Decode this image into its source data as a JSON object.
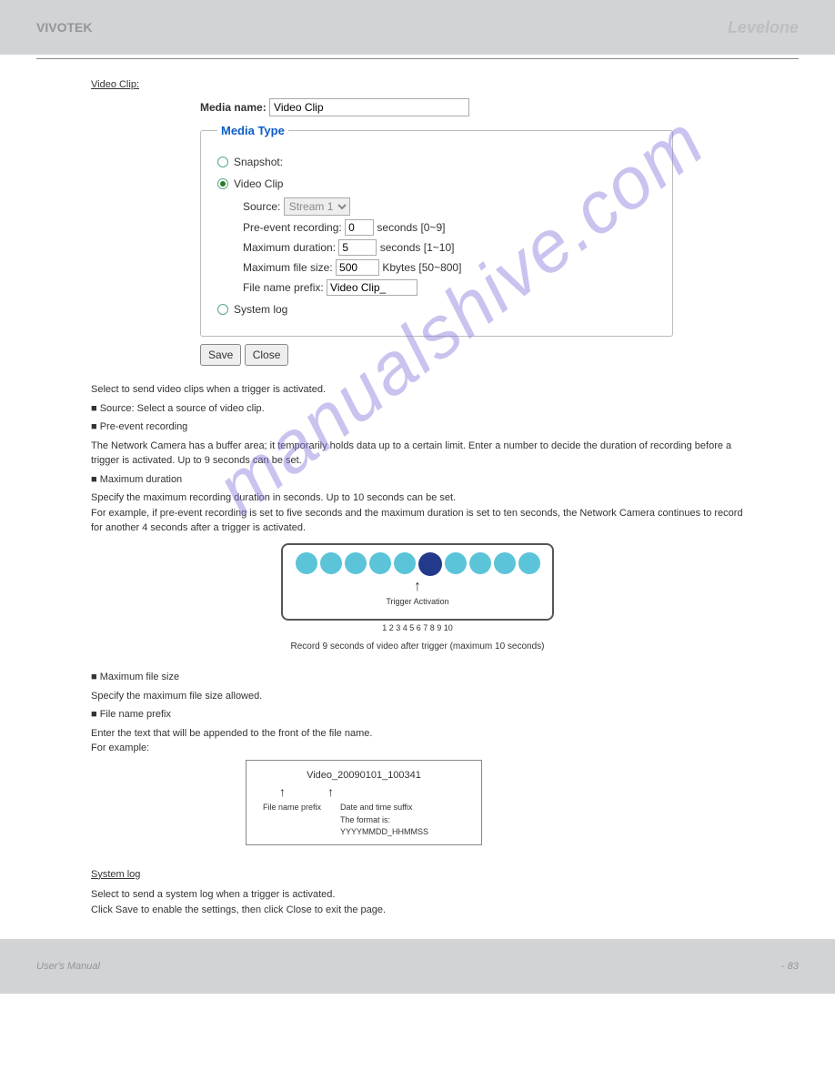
{
  "header": {
    "title": "VIVOTEK",
    "logo": "Levelone"
  },
  "watermark": "manualshive.com",
  "section_video_clip": "Video Clip:",
  "media_name_label": "Media name:",
  "media_name_value": "Video Clip",
  "fieldset_legend": "Media Type",
  "radios": {
    "snapshot": "Snapshot:",
    "video_clip": "Video Clip",
    "system_log": "System log"
  },
  "sub": {
    "source_label": "Source:",
    "source_value": "Stream 1",
    "pre_label": "Pre-event recording:",
    "pre_value": "0",
    "pre_suffix": "seconds [0~9]",
    "maxdur_label": "Maximum duration:",
    "maxdur_value": "5",
    "maxdur_suffix": "seconds [1~10]",
    "maxsize_label": "Maximum file size:",
    "maxsize_value": "500",
    "maxsize_suffix": "Kbytes [50~800]",
    "prefix_label": "File name prefix:",
    "prefix_value": "Video Clip_"
  },
  "buttons": {
    "save": "Save",
    "close": "Close"
  },
  "desc": {
    "select_media": "Select to send video clips when a trigger is activated.",
    "src_line": "■ Source: Select a source of video clip.",
    "pre_line": "■ Pre-event recording",
    "pre_text": "The Network Camera has a buffer area; it temporarily holds data up to a certain limit. Enter a number to decide the duration of recording before a trigger is activated. Up to 9 seconds can be set.",
    "maxdur_line": "■ Maximum duration",
    "maxdur_text": "Specify the maximum recording duration in seconds. Up to 10 seconds can be set.\nFor example, if pre-event recording is set to five seconds and the maximum duration is set to ten seconds, the Network Camera continues to record for another 4 seconds after a trigger is activated.",
    "maxsize_line": "■ Maximum file size",
    "maxsize_text": "Specify the maximum file size allowed.",
    "prefix_line": "■ File name prefix",
    "prefix_text": "Enter the text that will be appended to the front of the file name.\nFor example:"
  },
  "buffer": {
    "trigger": "Trigger Activation",
    "caption": "1 2 3 4 5 6 7 8 9 10",
    "window": "Record 9 seconds of video after trigger (maximum 10 seconds)"
  },
  "fname": {
    "example": "Video_20090101_100341",
    "arrow_left_label": "File name prefix",
    "arrow_right_label": "Date and time suffix\nThe format is: YYYYMMDD_HHMMSS"
  },
  "section_system_log": "System log",
  "system_log_text": "Select to send a system log when a trigger is activated.\nClick Save to enable the settings, then click Close to exit the page.",
  "footer": {
    "manual": "User's Manual",
    "page": "- 83"
  }
}
